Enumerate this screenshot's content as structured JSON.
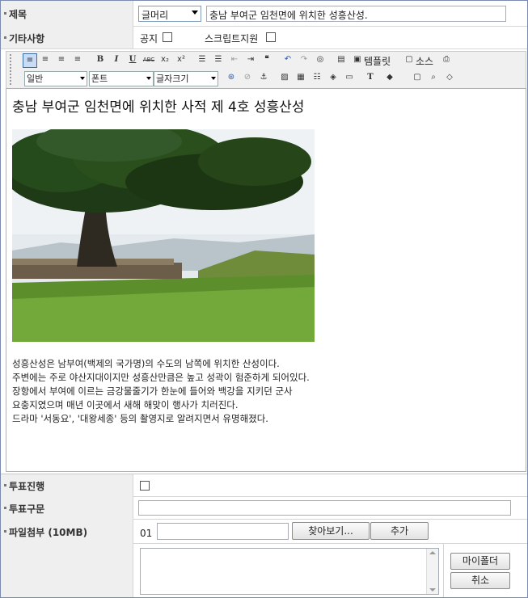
{
  "form": {
    "title_label": "제목",
    "title_category": "글머리",
    "title_value": "충남 부여군 임천면에 위치한 성흥산성.",
    "etc_label": "기타사항",
    "notice_label": "공지",
    "script_label": "스크립트지원",
    "vote_label": "투표진행",
    "vote_item_label": "투표구문",
    "file_label": "파일첨부 (10MB)",
    "file_index": "01",
    "browse_button": "찾아보기...",
    "add_button": "추가",
    "my_folder_button": "마이폴더",
    "cancel_button": "취소"
  },
  "toolbar": {
    "template_label": "템플릿",
    "source_label": "소스",
    "format_select": "일반",
    "font_select": "폰트",
    "size_select": "글자크기"
  },
  "editor": {
    "heading": "충남 부여군 임천면에 위치한 사적 제 4호 성흥산성",
    "lines": [
      "성흥산성은 남부여(백제의 국가명)의 수도의 남쪽에 위치한 산성이다.",
      "주변에는 주로 야산지대이지만 성흥산만큼은 높고 성곽이 험준하게 되어있다.",
      "장항에서 부여에 이르는 금강물줄기가 한눈에 들어와 백강을 지키던 군사",
      "요충지였으며 매년 이곳에서 새해 해맞이 행사가 치러진다.",
      "드라마 '서동요', '대왕세종' 등의 촬영지로 알려지면서 유명해졌다."
    ]
  }
}
